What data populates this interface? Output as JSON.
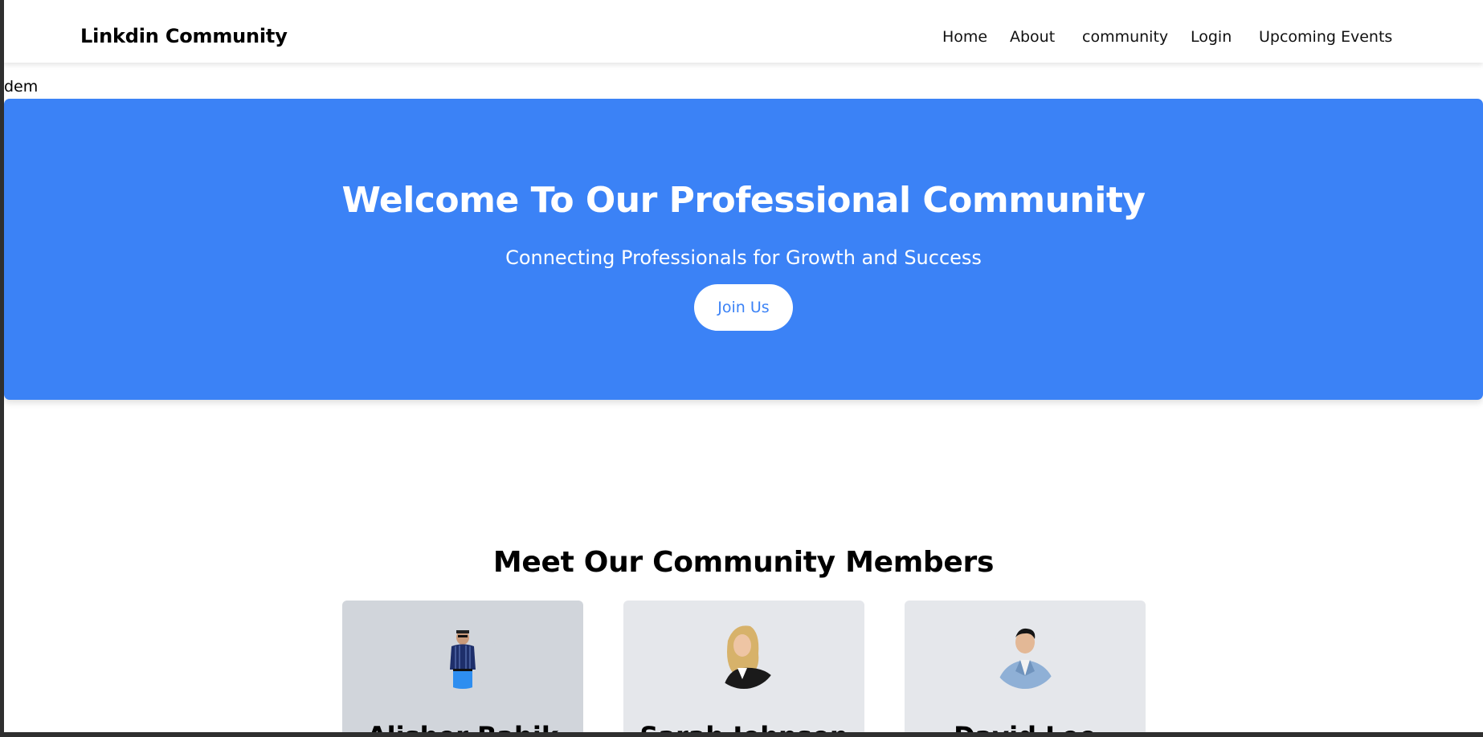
{
  "navbar": {
    "brand": "Linkdin Community",
    "links": [
      "Home",
      "About",
      "community",
      "Login",
      "Upcoming Events"
    ]
  },
  "stray_text": "dem",
  "hero": {
    "title": "Welcome To Our Professional Community",
    "subtitle": "Connecting Professionals for Growth and Success",
    "cta_label": "Join Us"
  },
  "members": {
    "title": "Meet Our Community Members",
    "cards": [
      {
        "name": "Alisher Babik",
        "avatar": "man-standing-photo"
      },
      {
        "name": "Sarah Johnson",
        "avatar": "woman-blonde-photo"
      },
      {
        "name": "David Lee",
        "avatar": "man-suit-photo"
      }
    ]
  },
  "colors": {
    "accent": "#3b82f6",
    "card_active": "#d1d5db",
    "card": "#e5e7eb",
    "text": "#000000"
  }
}
